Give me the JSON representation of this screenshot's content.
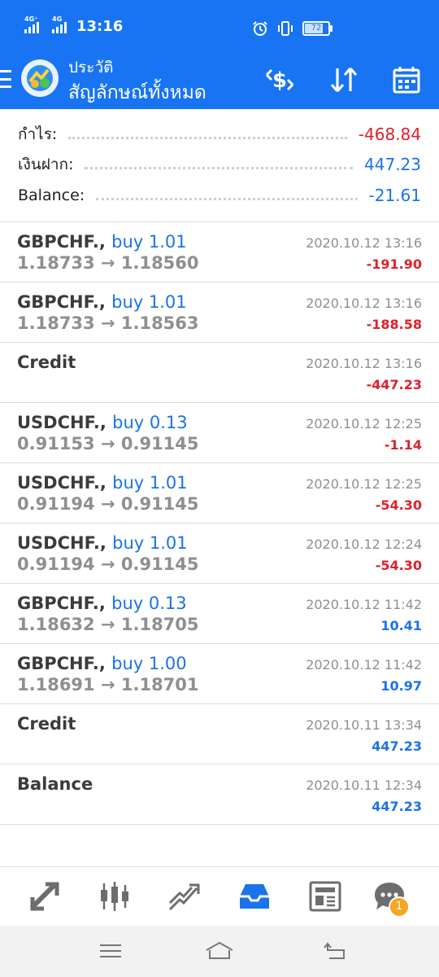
{
  "status_bar": {
    "net1": "4G⁺",
    "net2": "4G",
    "time": "13:16",
    "battery": "72"
  },
  "header": {
    "title": "ประวัติ",
    "subtitle": "สัญลักษณ์ทั้งหมด"
  },
  "summary": [
    {
      "label": "กำไร:",
      "value": "-468.84",
      "color": "#e0202a"
    },
    {
      "label": "เงินฝาก:",
      "value": "447.23",
      "color": "#1a73e8"
    },
    {
      "label": "Balance:",
      "value": "-21.61",
      "color": "#1a73e8"
    }
  ],
  "deals": [
    {
      "symbol": "GBPCHF.,",
      "action": "buy 1.01",
      "prices": "1.18733 → 1.18560",
      "datetime": "2020.10.12 13:16",
      "pl": "-191.90",
      "pl_color": "#e0202a"
    },
    {
      "symbol": "GBPCHF.,",
      "action": "buy 1.01",
      "prices": "1.18733 → 1.18563",
      "datetime": "2020.10.12 13:16",
      "pl": "-188.58",
      "pl_color": "#e0202a"
    },
    {
      "symbol": "Credit",
      "action": "",
      "prices": "",
      "datetime": "2020.10.12 13:16",
      "pl": "-447.23",
      "pl_color": "#e0202a"
    },
    {
      "symbol": "USDCHF.,",
      "action": "buy 0.13",
      "prices": "0.91153 → 0.91145",
      "datetime": "2020.10.12 12:25",
      "pl": "-1.14",
      "pl_color": "#e0202a"
    },
    {
      "symbol": "USDCHF.,",
      "action": "buy 1.01",
      "prices": "0.91194 → 0.91145",
      "datetime": "2020.10.12 12:25",
      "pl": "-54.30",
      "pl_color": "#e0202a"
    },
    {
      "symbol": "USDCHF.,",
      "action": "buy 1.01",
      "prices": "0.91194 → 0.91145",
      "datetime": "2020.10.12 12:24",
      "pl": "-54.30",
      "pl_color": "#e0202a"
    },
    {
      "symbol": "GBPCHF.,",
      "action": "buy 0.13",
      "prices": "1.18632 → 1.18705",
      "datetime": "2020.10.12 11:42",
      "pl": "10.41",
      "pl_color": "#1a73e8"
    },
    {
      "symbol": "GBPCHF.,",
      "action": "buy 1.00",
      "prices": "1.18691 → 1.18701",
      "datetime": "2020.10.12 11:42",
      "pl": "10.97",
      "pl_color": "#1a73e8"
    },
    {
      "symbol": "Credit",
      "action": "",
      "prices": "",
      "datetime": "2020.10.11 13:34",
      "pl": "447.23",
      "pl_color": "#1a73e8"
    },
    {
      "symbol": "Balance",
      "action": "",
      "prices": "",
      "datetime": "2020.10.11 12:34",
      "pl": "447.23",
      "pl_color": "#1a73e8"
    }
  ],
  "bottom_nav": {
    "items": [
      "quotes-icon",
      "chart-icon",
      "trade-icon",
      "history-icon",
      "news-icon",
      "chat-icon"
    ],
    "active": "history-icon",
    "chat_badge": "1"
  },
  "colors": {
    "header_bg": "#1874f3",
    "negative": "#e0202a",
    "positive": "#1a73e8"
  }
}
